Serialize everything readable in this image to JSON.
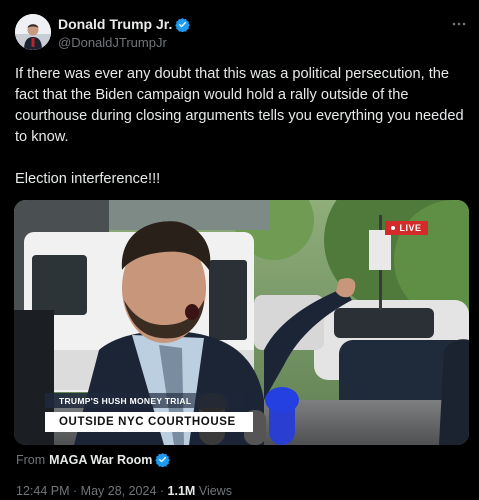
{
  "author": {
    "name": "Donald Trump Jr.",
    "handle": "@DonaldJTrumpJr"
  },
  "tweet": {
    "text": "If there was ever any doubt that this was a political persecution, the fact that the Biden campaign would hold a rally outside of the courthouse during closing arguments tells you everything you needed to know.\n\nElection interference!!!"
  },
  "video": {
    "live_badge": "LIVE",
    "lower_third_top": "TRUMP'S HUSH MONEY TRIAL",
    "lower_third_main": "OUTSIDE NYC COURTHOUSE"
  },
  "source": {
    "prefix": "From",
    "name": "MAGA War Room"
  },
  "meta": {
    "time": "12:44 PM",
    "separator": "·",
    "date": "May 28, 2024",
    "views_count": "1.1M",
    "views_label": "Views"
  },
  "colors": {
    "verified": "#1d9bf0",
    "live_badge": "#d32a2a"
  }
}
